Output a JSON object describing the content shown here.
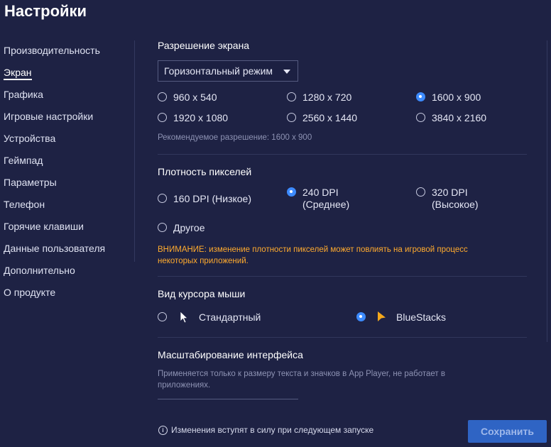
{
  "title": "Настройки",
  "sidebar": {
    "items": [
      {
        "label": "Производительность"
      },
      {
        "label": "Экран"
      },
      {
        "label": "Графика"
      },
      {
        "label": "Игровые настройки"
      },
      {
        "label": "Устройства"
      },
      {
        "label": "Геймпад"
      },
      {
        "label": "Параметры"
      },
      {
        "label": "Телефон"
      },
      {
        "label": "Горячие клавиши"
      },
      {
        "label": "Данные пользователя"
      },
      {
        "label": "Дополнительно"
      },
      {
        "label": "О продукте"
      }
    ],
    "active": "Экран"
  },
  "resolution": {
    "title": "Разрешение экрана",
    "mode": "Горизонтальный режим",
    "options": [
      "960 x 540",
      "1280 x 720",
      "1600 x 900",
      "1920 x 1080",
      "2560 x 1440",
      "3840 x 2160"
    ],
    "selected": "1600 x 900",
    "recommended": "Рекомендуемое разрешение: 1600 x 900"
  },
  "dpi": {
    "title": "Плотность пикселей",
    "options": [
      {
        "line1": "160 DPI (Низкое)",
        "line2": ""
      },
      {
        "line1": "240 DPI",
        "line2": "(Среднее)"
      },
      {
        "line1": "320 DPI",
        "line2": "(Высокое)"
      },
      {
        "line1": "Другое",
        "line2": ""
      }
    ],
    "selected": "240 DPI",
    "warning_line1": "ВНИМАНИЕ: изменение плотности пикселей может повлиять на игровой процесс",
    "warning_line2": "некоторых приложений."
  },
  "cursor": {
    "title": "Вид курсора мыши",
    "options": [
      "Стандартный",
      "BlueStacks"
    ],
    "selected": "BlueStacks"
  },
  "scaling": {
    "title": "Масштабирование интерфейса",
    "hint_line1": "Применяется только к размеру текста и значков в App Player, не работает в",
    "hint_line2": "приложениях."
  },
  "footer": {
    "note": "Изменения вступят в силу при следующем запуске",
    "save_label": "Сохранить"
  },
  "colors": {
    "background": "#1e2244",
    "accent": "#3d8bff",
    "warning": "#ffab2e",
    "save_button": "#2f64c4"
  }
}
